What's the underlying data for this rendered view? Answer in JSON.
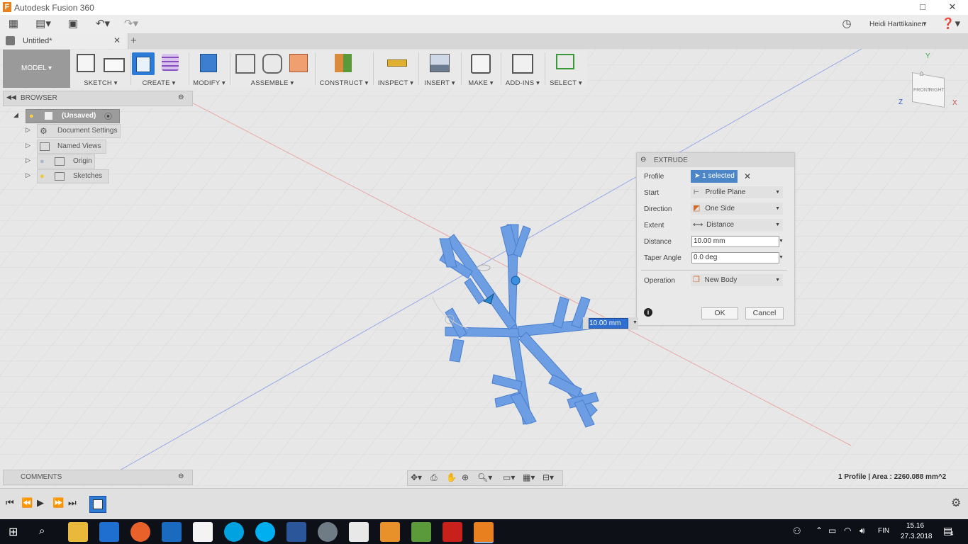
{
  "window": {
    "app_title": "Autodesk Fusion 360"
  },
  "appbar": {
    "user": "Heidi Harttikainen"
  },
  "tab": {
    "title": "Untitled*"
  },
  "toolbar": {
    "workspace": "MODEL",
    "groups": [
      "SKETCH",
      "CREATE",
      "MODIFY",
      "ASSEMBLE",
      "CONSTRUCT",
      "INSPECT",
      "INSERT",
      "MAKE",
      "ADD-INS",
      "SELECT"
    ]
  },
  "browser": {
    "header": "BROWSER",
    "root": "(Unsaved)",
    "items": [
      "Document Settings",
      "Named Views",
      "Origin",
      "Sketches"
    ]
  },
  "extrude": {
    "title": "EXTRUDE",
    "rows": [
      {
        "label": "Profile",
        "value": "1 selected"
      },
      {
        "label": "Start",
        "value": "Profile Plane"
      },
      {
        "label": "Direction",
        "value": "One Side"
      },
      {
        "label": "Extent",
        "value": "Distance"
      },
      {
        "label": "Distance",
        "value": "10.00 mm"
      },
      {
        "label": "Taper Angle",
        "value": "0.0 deg"
      },
      {
        "label": "Operation",
        "value": "New Body"
      }
    ],
    "ok": "OK",
    "cancel": "Cancel"
  },
  "viewport": {
    "distance_value": "10.00 mm",
    "status": "1 Profile | Area : 2260.088 mm^2"
  },
  "viewcube": {
    "front": "FRONT",
    "right": "RIGHT",
    "x": "X",
    "y": "Y",
    "z": "Z"
  },
  "comments": {
    "header": "COMMENTS"
  },
  "taskbar": {
    "lang": "FIN",
    "time": "15.16",
    "date": "27.3.2018",
    "notifications": "4"
  },
  "colors": {
    "sketch_blue": "#6b9be0",
    "accent_blue": "#2c7bd6",
    "model_gray": "#9a9a9a"
  }
}
